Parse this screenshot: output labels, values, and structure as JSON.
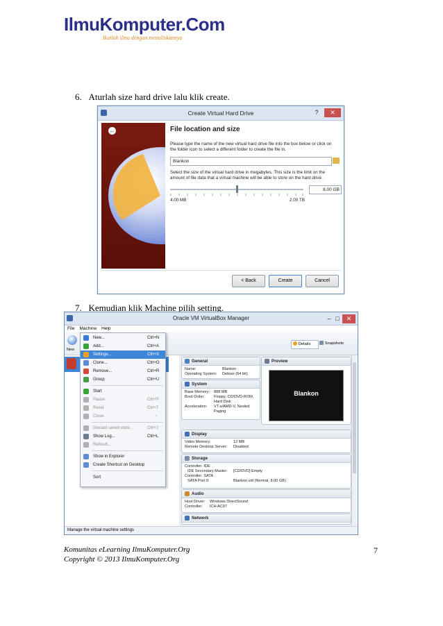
{
  "logo": {
    "brand": "IlmuKomputer.Com",
    "tagline": "Ikatlah ilmu dengan menuliskannya"
  },
  "steps": {
    "step6": "6.   Aturlah size hard drive lalu klik create.",
    "step7": "7.   Kemudian klik Machine pilih setting."
  },
  "dialog1": {
    "title": "Create Virtual Hard Drive",
    "help": "?",
    "close": "✕",
    "heading": "File location and size",
    "desc1": "Please type the name of the new virtual hard drive file into the box below or click on the folder icon to select a different folder to create the file in.",
    "file_value": "Blankon",
    "desc2": "Select the size of the virtual hard drive in megabytes. This size is the limit on the amount of file data that a virtual machine will be able to store on the hard drive.",
    "size_value": "8.00 GB",
    "slider_fraction": 0.5,
    "min_label": "4.00 MB",
    "max_label": "2.00 TB",
    "back_label": "< Back",
    "create_label": "Create",
    "cancel_label": "Cancel"
  },
  "dialog2": {
    "title": "Oracle VM VirtualBox Manager",
    "menubar": [
      "File",
      "Machine",
      "Help"
    ],
    "toolbar_new": "New",
    "tab_details": "Details",
    "tab_snapshots": "Snapshots",
    "menu": [
      {
        "label": "New...",
        "shortcut": "Ctrl+N",
        "color": "#3a7bd5"
      },
      {
        "label": "Add...",
        "shortcut": "Ctrl+A",
        "color": "#3aa43a"
      },
      {
        "label": "Settings...",
        "shortcut": "Ctrl+S",
        "color": "#e8a325"
      },
      {
        "label": "Clone...",
        "shortcut": "Ctrl+O",
        "color": "#5c8fd1"
      },
      {
        "label": "Remove...",
        "shortcut": "Ctrl+R",
        "color": "#d24a3a"
      },
      {
        "label": "Group",
        "shortcut": "Ctrl+U",
        "color": "#4a9a4a"
      },
      {
        "label": "Start",
        "shortcut": "",
        "color": "#3aa43a"
      },
      {
        "label": "Pause",
        "shortcut": "Ctrl+P",
        "color": "#b0b0b0"
      },
      {
        "label": "Reset",
        "shortcut": "Ctrl+T",
        "color": "#b0b0b0"
      },
      {
        "label": "Close",
        "shortcut": "›",
        "color": "#b0b0b0"
      },
      {
        "label": "Discard saved state...",
        "shortcut": "Ctrl+J",
        "color": "#b0b0b0"
      },
      {
        "label": "Show Log...",
        "shortcut": "Ctrl+L",
        "color": "#6c7c90"
      },
      {
        "label": "Refresh...",
        "shortcut": "",
        "color": "#b0b0b0"
      },
      {
        "label": "Show in Explorer",
        "shortcut": "",
        "color": "#5c8fd1"
      },
      {
        "label": "Create Shortcut on Desktop",
        "shortcut": "",
        "color": "#5c8fd1"
      },
      {
        "label": "Sort",
        "shortcut": "",
        "color": ""
      }
    ],
    "general": {
      "title": "General",
      "k1": "Name:",
      "v1": "Blankon",
      "k2": "Operating System:",
      "v2": "Debian (64 bit)"
    },
    "preview": {
      "title": "Preview",
      "vm_name": "Blankon"
    },
    "system": {
      "title": "System",
      "k1": "Base Memory:",
      "v1": "888 MB",
      "k2": "Boot Order:",
      "v2a": "Floppy, CD/DVD-ROM,",
      "v2b": "Hard Disk",
      "k3": "Acceleration:",
      "v3a": "VT-x/AMD-V, Nested",
      "v3b": "Paging"
    },
    "display": {
      "title": "Display",
      "k1": "Video Memory:",
      "v1": "12 MB",
      "k2": "Remote Desktop Server:",
      "v2": "Disabled"
    },
    "storage": {
      "title": "Storage",
      "l1": "Controller: IDE",
      "k2": "IDE Secondary Master:",
      "v2": "[CD/DVD] Empty",
      "l3": "Controller: SATA",
      "k4": "SATA Port 0:",
      "v4": "Blankon.vdi (Normal, 8.00 GB)"
    },
    "audio": {
      "title": "Audio",
      "k1": "Host Driver:",
      "v1": "Windows DirectSound",
      "k2": "Controller:",
      "v2": "ICH AC97"
    },
    "network": {
      "title": "Network"
    },
    "status": "Manage the virtual machine settings"
  },
  "footer": {
    "line1": "Komunitas eLearning IlmuKomputer.Org",
    "line2": "Copyright © 2013 IlmuKomputer.Org",
    "page_number": "7"
  }
}
